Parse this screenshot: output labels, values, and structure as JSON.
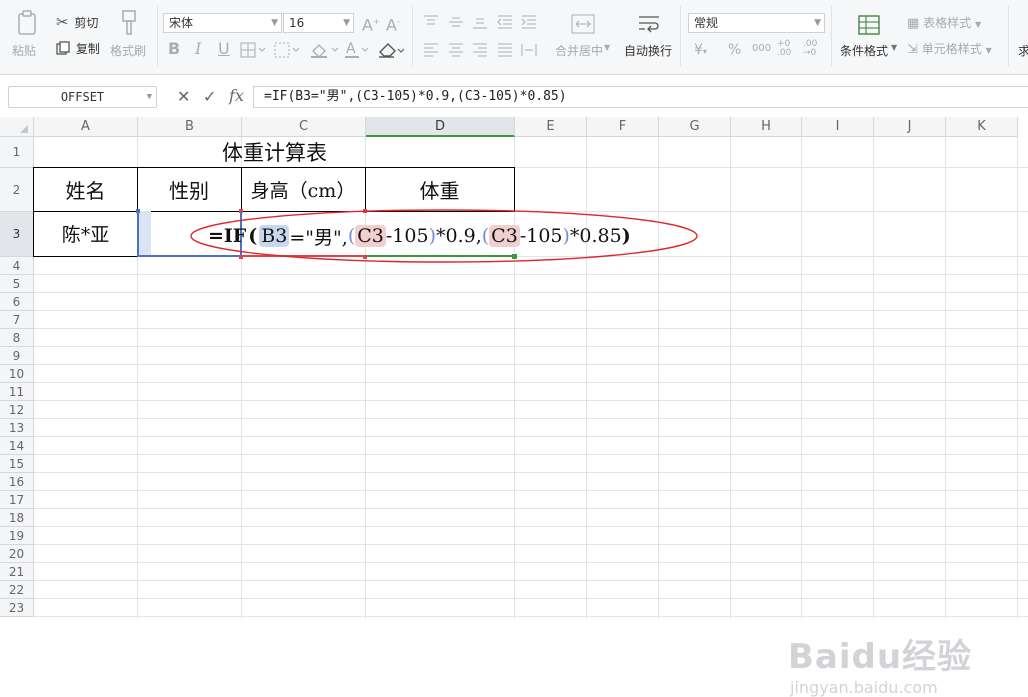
{
  "ribbon": {
    "paste_label": "粘贴",
    "cut_label": "剪切",
    "copy_label": "复制",
    "format_painter_label": "格式刷",
    "font_name": "宋体",
    "font_size": "16",
    "bold_glyph": "B",
    "italic_glyph": "I",
    "underline_glyph": "U",
    "merge_center_label": "合并居中",
    "wrap_text_label": "自动换行",
    "number_format": "常规",
    "conditional_format_label": "条件格式",
    "table_style_label": "表格样式",
    "cell_style_label": "单元格样式",
    "cut_off_label": "求"
  },
  "formula_bar": {
    "name_box": "OFFSET",
    "cancel_glyph": "✕",
    "confirm_glyph": "✓",
    "fx_label": "fx",
    "formula": "=IF(B3=\"男\",(C3-105)*0.9,(C3-105)*0.85)"
  },
  "columns": [
    "A",
    "B",
    "C",
    "D",
    "E",
    "F",
    "G",
    "H",
    "I",
    "J",
    "K"
  ],
  "rows": [
    "1",
    "2",
    "3",
    "4",
    "5",
    "6",
    "7",
    "8",
    "9",
    "10",
    "11",
    "12",
    "13",
    "14",
    "15",
    "16",
    "17",
    "18",
    "19",
    "20",
    "21",
    "22",
    "23"
  ],
  "sheet": {
    "title": "体重计算表",
    "headers": [
      "姓名",
      "性别",
      "身高（cm）",
      "体重"
    ],
    "row3_name": "陈*亚",
    "inline_formula": {
      "p1": "=IF",
      "p2": "(",
      "ref1": "B3",
      "p3": "=\"男\",",
      "p4": "(",
      "ref2": "C3",
      "p5": "-105",
      "p6": ")",
      "p7": "*0.9,",
      "p8": "(",
      "ref3": "C3",
      "p9": "-105",
      "p10": ")",
      "p11": "*0.85",
      "p12": ")"
    }
  },
  "watermark": {
    "brand": "Baidu经验",
    "url": "jingyan.baidu.com"
  },
  "colors": {
    "annotation": "#e0252b",
    "selection_green": "#3b9a3a",
    "ref_blue": "#c9d6ef",
    "ref_red": "#f1cfcf"
  }
}
